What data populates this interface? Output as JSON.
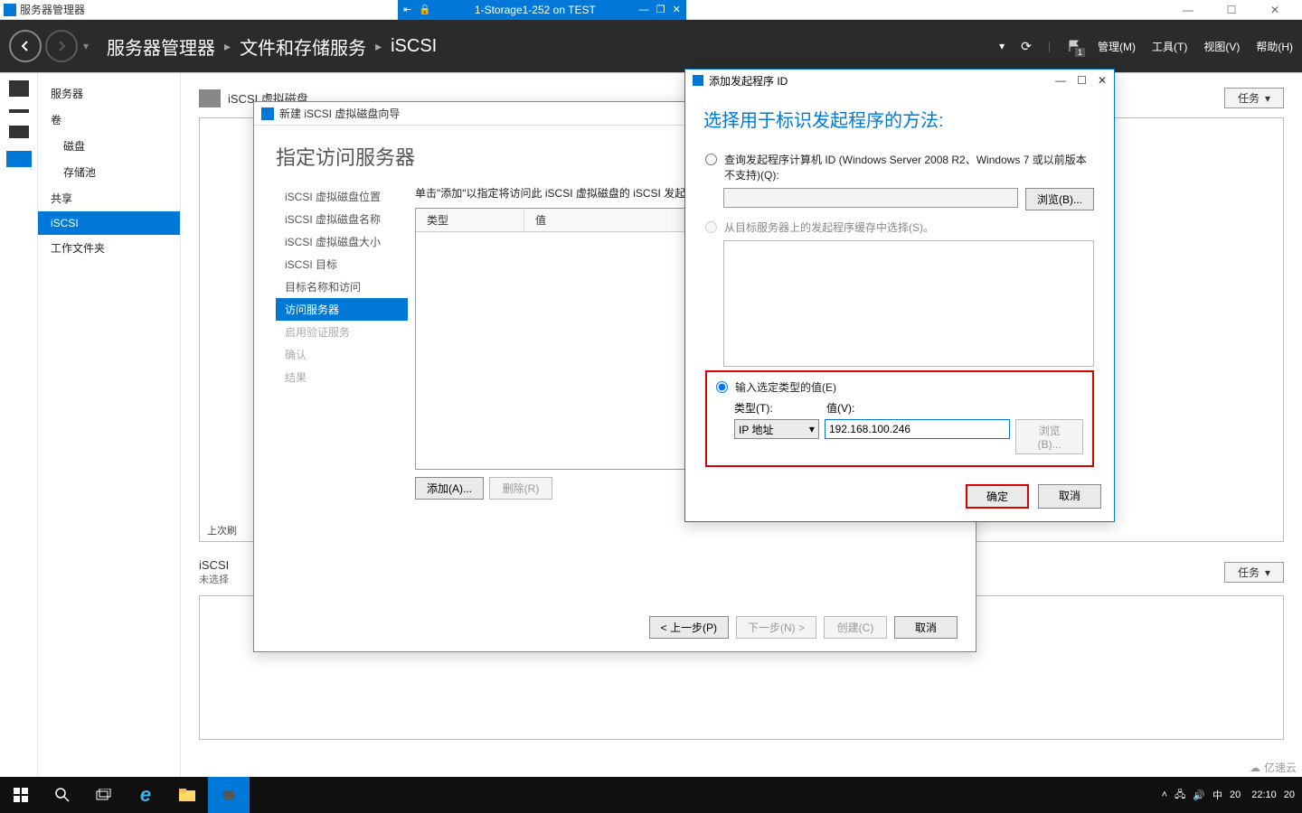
{
  "vm_titlebar": {
    "app_title": "服务器管理器",
    "connection": "1-Storage1-252 on TEST"
  },
  "sm_header": {
    "crumb1": "服务器管理器",
    "crumb2": "文件和存储服务",
    "crumb3": "iSCSI",
    "menu_manage": "管理(M)",
    "menu_tools": "工具(T)",
    "menu_view": "视图(V)",
    "menu_help": "帮助(H)"
  },
  "side_nav": {
    "servers": "服务器",
    "volumes": "卷",
    "disks": "磁盘",
    "pools": "存储池",
    "shares": "共享",
    "iscsi": "iSCSI",
    "workfolders": "工作文件夹"
  },
  "content": {
    "section1_title": "iSCSI 虚拟磁盘",
    "section2_title": "iSCSI",
    "section2_sub": "未选择",
    "tasks_btn": "任务",
    "last_run": "上次刷"
  },
  "wizard": {
    "title": "新建 iSCSI 虚拟磁盘向导",
    "heading": "指定访问服务器",
    "steps": {
      "s1": "iSCSI 虚拟磁盘位置",
      "s2": "iSCSI 虚拟磁盘名称",
      "s3": "iSCSI 虚拟磁盘大小",
      "s4": "iSCSI 目标",
      "s5": "目标名称和访问",
      "s6": "访问服务器",
      "s7": "启用验证服务",
      "s8": "确认",
      "s9": "结果"
    },
    "hint": "单击\"添加\"以指定将访问此 iSCSI 虚拟磁盘的 iSCSI 发起",
    "th_type": "类型",
    "th_value": "值",
    "btn_add": "添加(A)...",
    "btn_remove": "删除(R)",
    "btn_prev": "< 上一步(P)",
    "btn_next": "下一步(N) >",
    "btn_create": "创建(C)",
    "btn_cancel": "取消"
  },
  "initiator": {
    "title": "添加发起程序 ID",
    "heading": "选择用于标识发起程序的方法:",
    "opt1": "查询发起程序计算机 ID (Windows Server 2008 R2、Windows 7 或以前版本不支持)(Q):",
    "opt2": "从目标服务器上的发起程序缓存中选择(S)。",
    "opt3": "输入选定类型的值(E)",
    "browse": "浏览(B)...",
    "lbl_type": "类型(T):",
    "lbl_value": "值(V):",
    "type_value": "IP 地址",
    "value_input": "192.168.100.246",
    "btn_ok": "确定",
    "btn_cancel": "取消"
  },
  "taskbar": {
    "time": "22:10",
    "ime": "中",
    "tmp": "20",
    "tmp2": "20"
  },
  "watermark": "亿速云"
}
